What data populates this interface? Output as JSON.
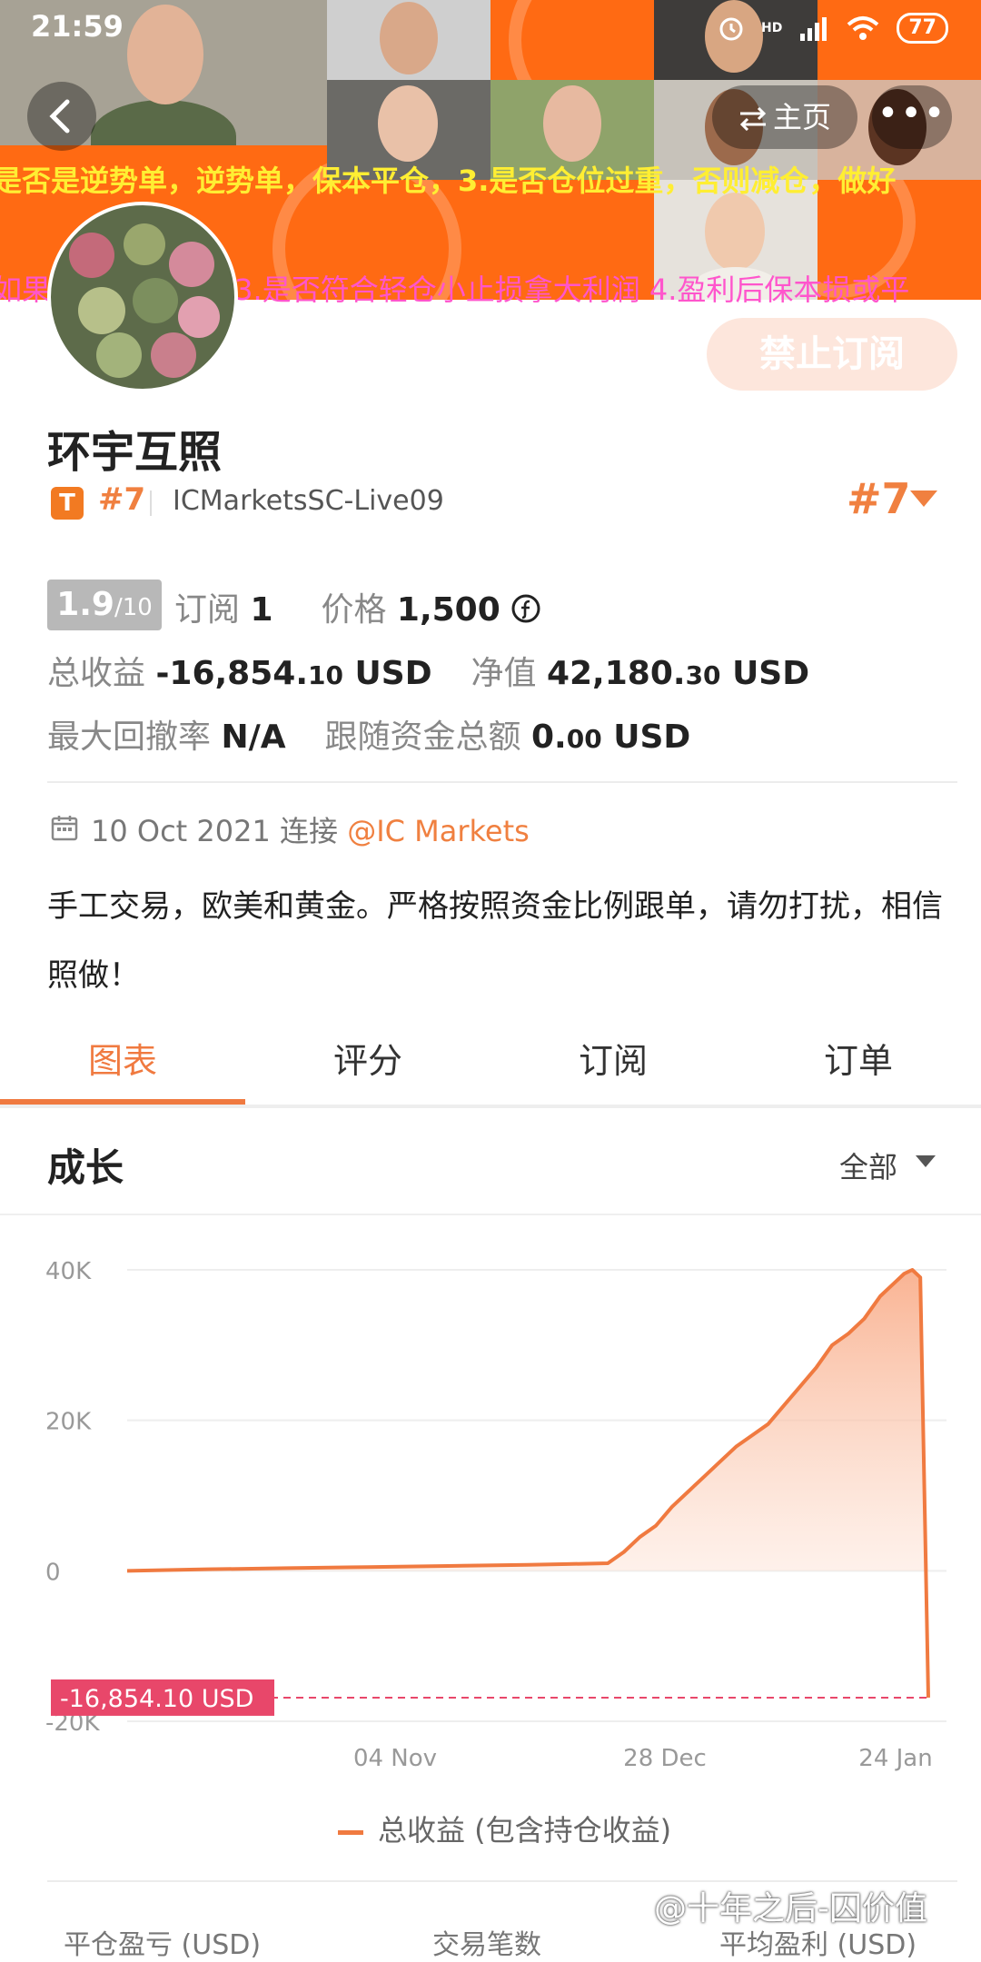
{
  "status_bar": {
    "time": "21:59",
    "network": "HD",
    "battery": "77"
  },
  "nav": {
    "home_label": "主页",
    "more_label": "•••",
    "back_icon": "chevron-left-icon"
  },
  "marquee": {
    "line1": "是否是逆势单，逆势单，保本平仓，3.是否仓位过重，否则减仓，做好",
    "line2": "如果有，立即平仓 3.是否符合轻仓小止损拿大利润 4.盈利后保本损或平"
  },
  "subscribe_button": "禁止订阅",
  "profile": {
    "name": "环宇互照",
    "badge": "T",
    "rank_small": "#7",
    "server": "ICMarketsSC-Live09",
    "rank_big": "#7"
  },
  "stats": {
    "score": "1.9",
    "score_max": "/10",
    "subscribe_label": "订阅",
    "subscribe_count": "1",
    "price_label": "价格",
    "price_value": "1,500",
    "total_profit_label": "总收益",
    "total_profit_int": "-16,854.",
    "total_profit_dec": "10",
    "total_profit_unit": "USD",
    "equity_label": "净值",
    "equity_int": "42,180.",
    "equity_dec": "30",
    "equity_unit": "USD",
    "drawdown_label": "最大回撤率",
    "drawdown_value": "N/A",
    "follow_label": "跟随资金总额",
    "follow_int": "0.",
    "follow_dec": "00",
    "follow_unit": "USD"
  },
  "connect": {
    "date": "10 Oct 2021",
    "label": "连接",
    "broker": "@IC Markets"
  },
  "description": "手工交易，欧美和黄金。严格按照资金比例跟单，请勿打扰，相信照做！",
  "tabs": [
    "图表",
    "评分",
    "订阅",
    "订单"
  ],
  "section": {
    "title": "成长",
    "filter": "全部"
  },
  "chart_data": {
    "type": "area",
    "title": "",
    "xlabel": "",
    "ylabel": "",
    "ylim": [
      -20000,
      40000
    ],
    "y_ticks": [
      "40K",
      "20K",
      "0",
      "-20K"
    ],
    "y_tick_values": [
      40000,
      20000,
      0,
      -20000
    ],
    "x_ticks": [
      "04 Nov",
      "28 Dec",
      "24 Jan"
    ],
    "x": [
      0,
      10,
      20,
      30,
      40,
      50,
      55,
      60,
      62,
      64,
      66,
      68,
      70,
      72,
      74,
      76,
      78,
      80,
      82,
      84,
      86,
      88,
      90,
      92,
      94,
      95,
      96,
      97,
      98,
      99,
      100
    ],
    "series": [
      {
        "name": "总收益 (包含持仓收益)",
        "values": [
          0,
          200,
          350,
          500,
          650,
          800,
          900,
          1000,
          2500,
          4500,
          6000,
          8500,
          10500,
          12500,
          14500,
          16500,
          18000,
          19500,
          22000,
          24500,
          27000,
          30000,
          31500,
          33500,
          36500,
          37500,
          38500,
          39500,
          40000,
          39000,
          -16854.1
        ]
      }
    ],
    "annotation": {
      "label": "-16,854.10 USD",
      "value": -16854.1
    },
    "colors": {
      "line": "#f07a40",
      "fill": "#f8b79a",
      "annotation_bg": "#e8476a"
    }
  },
  "legend": {
    "label": "总收益 (包含持仓收益)"
  },
  "bottom_columns": [
    "平仓盈亏 (USD)",
    "交易笔数",
    "平均盈利 (USD)"
  ],
  "watermark": "@十年之后-囚价值",
  "colors": {
    "accent": "#f07a40",
    "banner": "#ff6a13",
    "subscribe_bg": "#fde6dc"
  }
}
